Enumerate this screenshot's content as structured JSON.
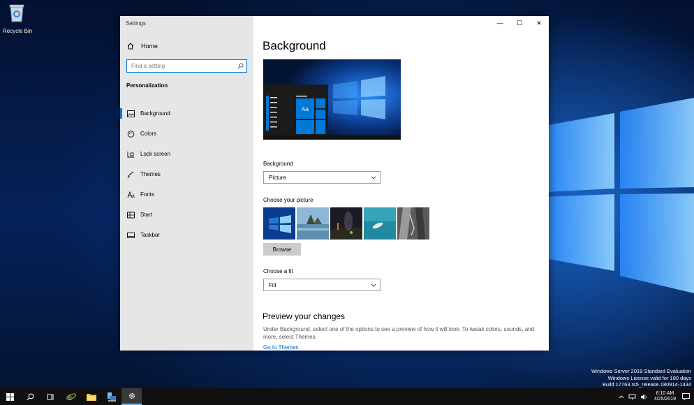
{
  "desktop": {
    "recycle_bin_label": "Recycle Bin",
    "watermark_lines": [
      "Windows Server 2019 Standard Evaluation",
      "Windows License valid for 180 days",
      "Build 17763.rs5_release.180914-1434"
    ]
  },
  "window": {
    "app_title": "Settings",
    "minimize": "—",
    "maximize": "☐",
    "close": "✕"
  },
  "nav": {
    "home_label": "Home",
    "search_placeholder": "Find a setting",
    "section_title": "Personalization",
    "items": [
      {
        "label": "Background",
        "icon": "picture-icon",
        "active": true
      },
      {
        "label": "Colors",
        "icon": "palette-icon",
        "active": false
      },
      {
        "label": "Lock screen",
        "icon": "lock-screen-icon",
        "active": false
      },
      {
        "label": "Themes",
        "icon": "brush-icon",
        "active": false
      },
      {
        "label": "Fonts",
        "icon": "font-icon",
        "active": false
      },
      {
        "label": "Start",
        "icon": "start-icon",
        "active": false
      },
      {
        "label": "Taskbar",
        "icon": "taskbar-icon",
        "active": false
      }
    ]
  },
  "main": {
    "title": "Background",
    "preview_tile_text": "Aa",
    "background_label": "Background",
    "background_value": "Picture",
    "choose_picture_label": "Choose your picture",
    "browse_label": "Browse",
    "choose_fit_label": "Choose a fit",
    "fit_value": "Fill",
    "preview_heading": "Preview your changes",
    "preview_desc": "Under Background, select one of the options to see a preview of how it will look. To tweak colors, sounds, and more, select Themes.",
    "themes_link": "Go to Themes"
  },
  "taskbar": {
    "time": "6:10 AM",
    "date": "4/25/2019"
  },
  "colors": {
    "accent": "#0078d7",
    "nav_bg": "#e6e6e6",
    "taskbar_bg": "#101010"
  }
}
